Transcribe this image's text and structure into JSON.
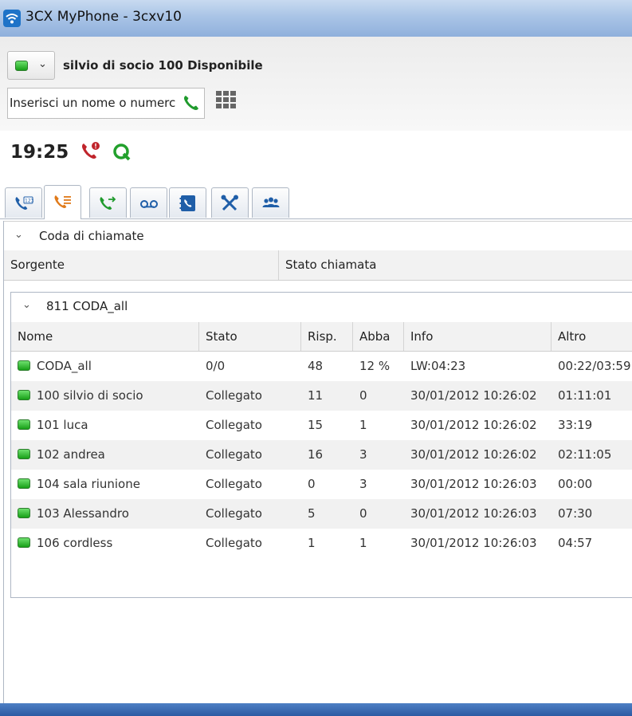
{
  "window": {
    "title": "3CX MyPhone - 3cxv10"
  },
  "header": {
    "user_status": "silvio di socio 100 Disponibile",
    "status_color": "#22aa22",
    "search": {
      "value": "Inserisci un nome o numerc"
    }
  },
  "clock": {
    "time": "19:25"
  },
  "tabs": [
    {
      "icon": "dialpad-phone-icon",
      "active": false
    },
    {
      "icon": "call-list-icon",
      "active": true
    },
    {
      "icon": "call-transfer-icon",
      "active": false
    },
    {
      "icon": "voicemail-icon",
      "active": false
    },
    {
      "icon": "phonebook-icon",
      "active": false
    },
    {
      "icon": "settings-tools-icon",
      "active": false
    },
    {
      "icon": "presence-group-icon",
      "active": false
    }
  ],
  "queue_panel": {
    "title": "Coda di chiamate",
    "columns": [
      "Sorgente",
      "Stato chiamata"
    ],
    "queue": {
      "title": "811 CODA_all",
      "columns": [
        "Nome",
        "Stato",
        "Risp.",
        "Abba",
        "Info",
        "Altro"
      ],
      "rows": [
        [
          "CODA_all",
          "0/0",
          "48",
          "12 %",
          "LW:04:23",
          "00:22/03:59"
        ],
        [
          "100 silvio di socio",
          "Collegato",
          "11",
          "0",
          "30/01/2012 10:26:02",
          "01:11:01"
        ],
        [
          "101 luca",
          "Collegato",
          "15",
          "1",
          "30/01/2012 10:26:02",
          "33:19"
        ],
        [
          "102 andrea",
          "Collegato",
          "16",
          "3",
          "30/01/2012 10:26:02",
          "02:11:05"
        ],
        [
          "104 sala riunione",
          "Collegato",
          "0",
          "3",
          "30/01/2012 10:26:03",
          "00:00"
        ],
        [
          "103 Alessandro",
          "Collegato",
          "5",
          "0",
          "30/01/2012 10:26:03",
          "07:30"
        ],
        [
          "106 cordless",
          "Collegato",
          "1",
          "1",
          "30/01/2012 10:26:03",
          "04:57"
        ]
      ]
    }
  }
}
